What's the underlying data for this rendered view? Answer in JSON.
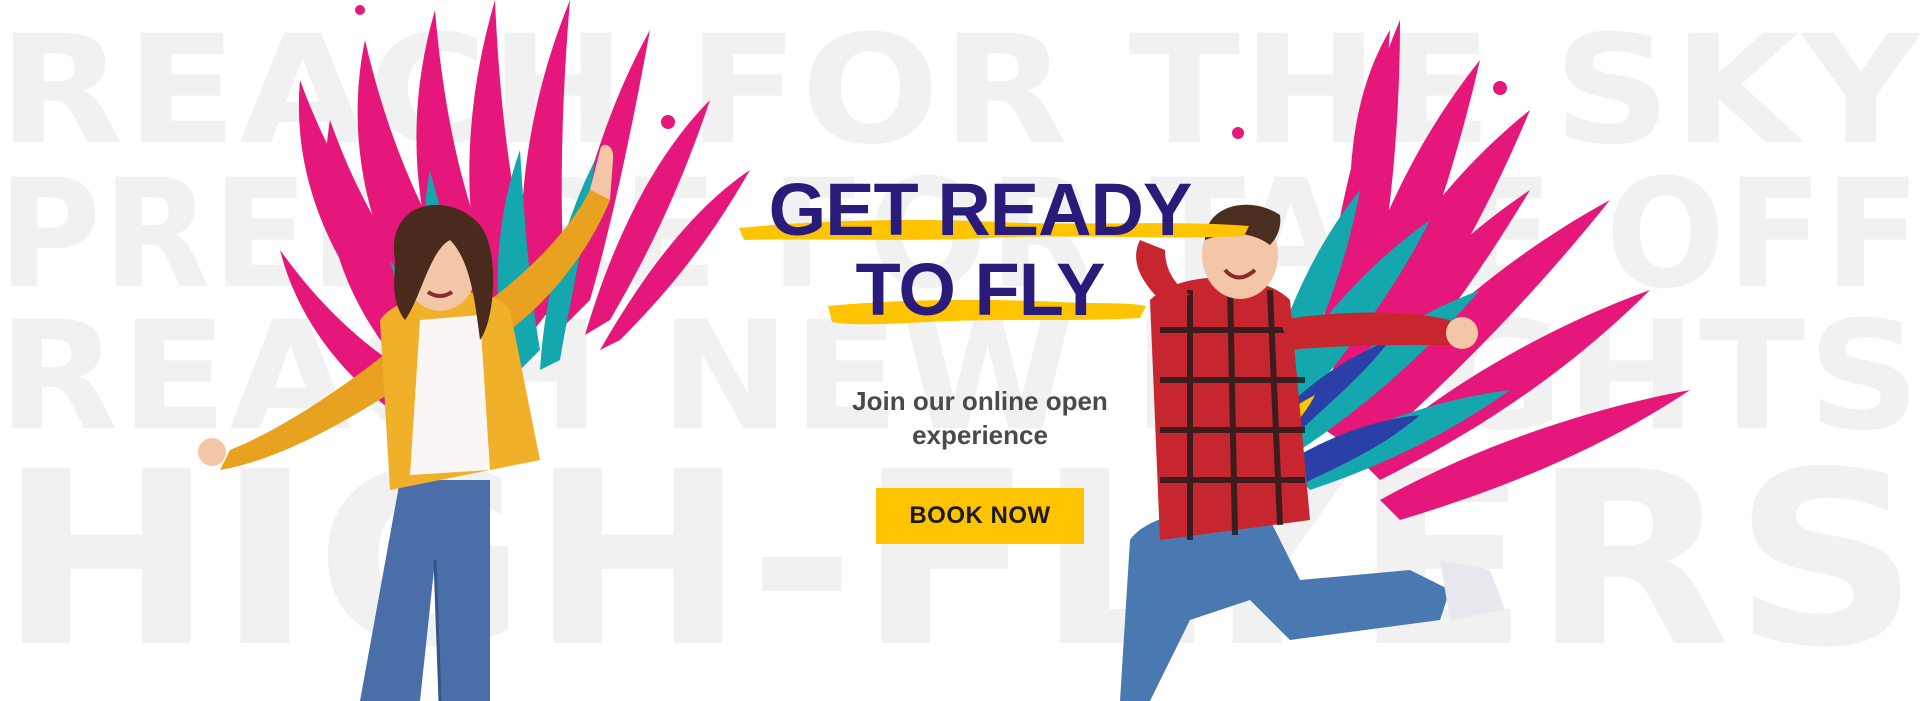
{
  "background_text": {
    "lines": [
      "REACH FOR THE SKY",
      "PREPARE FOR TAKE OFF",
      "REACH NEW HEIGHTS",
      "HIGH-FLYERS"
    ]
  },
  "hero": {
    "headline_line1": "GET READY",
    "headline_line2": "TO FLY",
    "subtitle": "Join our online open experience",
    "cta_label": "BOOK NOW"
  },
  "colors": {
    "headline": "#2a1a7a",
    "cta_background": "#ffc400",
    "brush_stroke": "#ffc400",
    "wing_magenta": "#e5177b",
    "wing_teal": "#14a7ad",
    "wing_blue": "#2a3fa8",
    "background_text": "#f1f1f1"
  },
  "icons": {
    "left_figure": "girl-with-wings-illustration",
    "right_figure": "boy-with-wings-illustration"
  }
}
